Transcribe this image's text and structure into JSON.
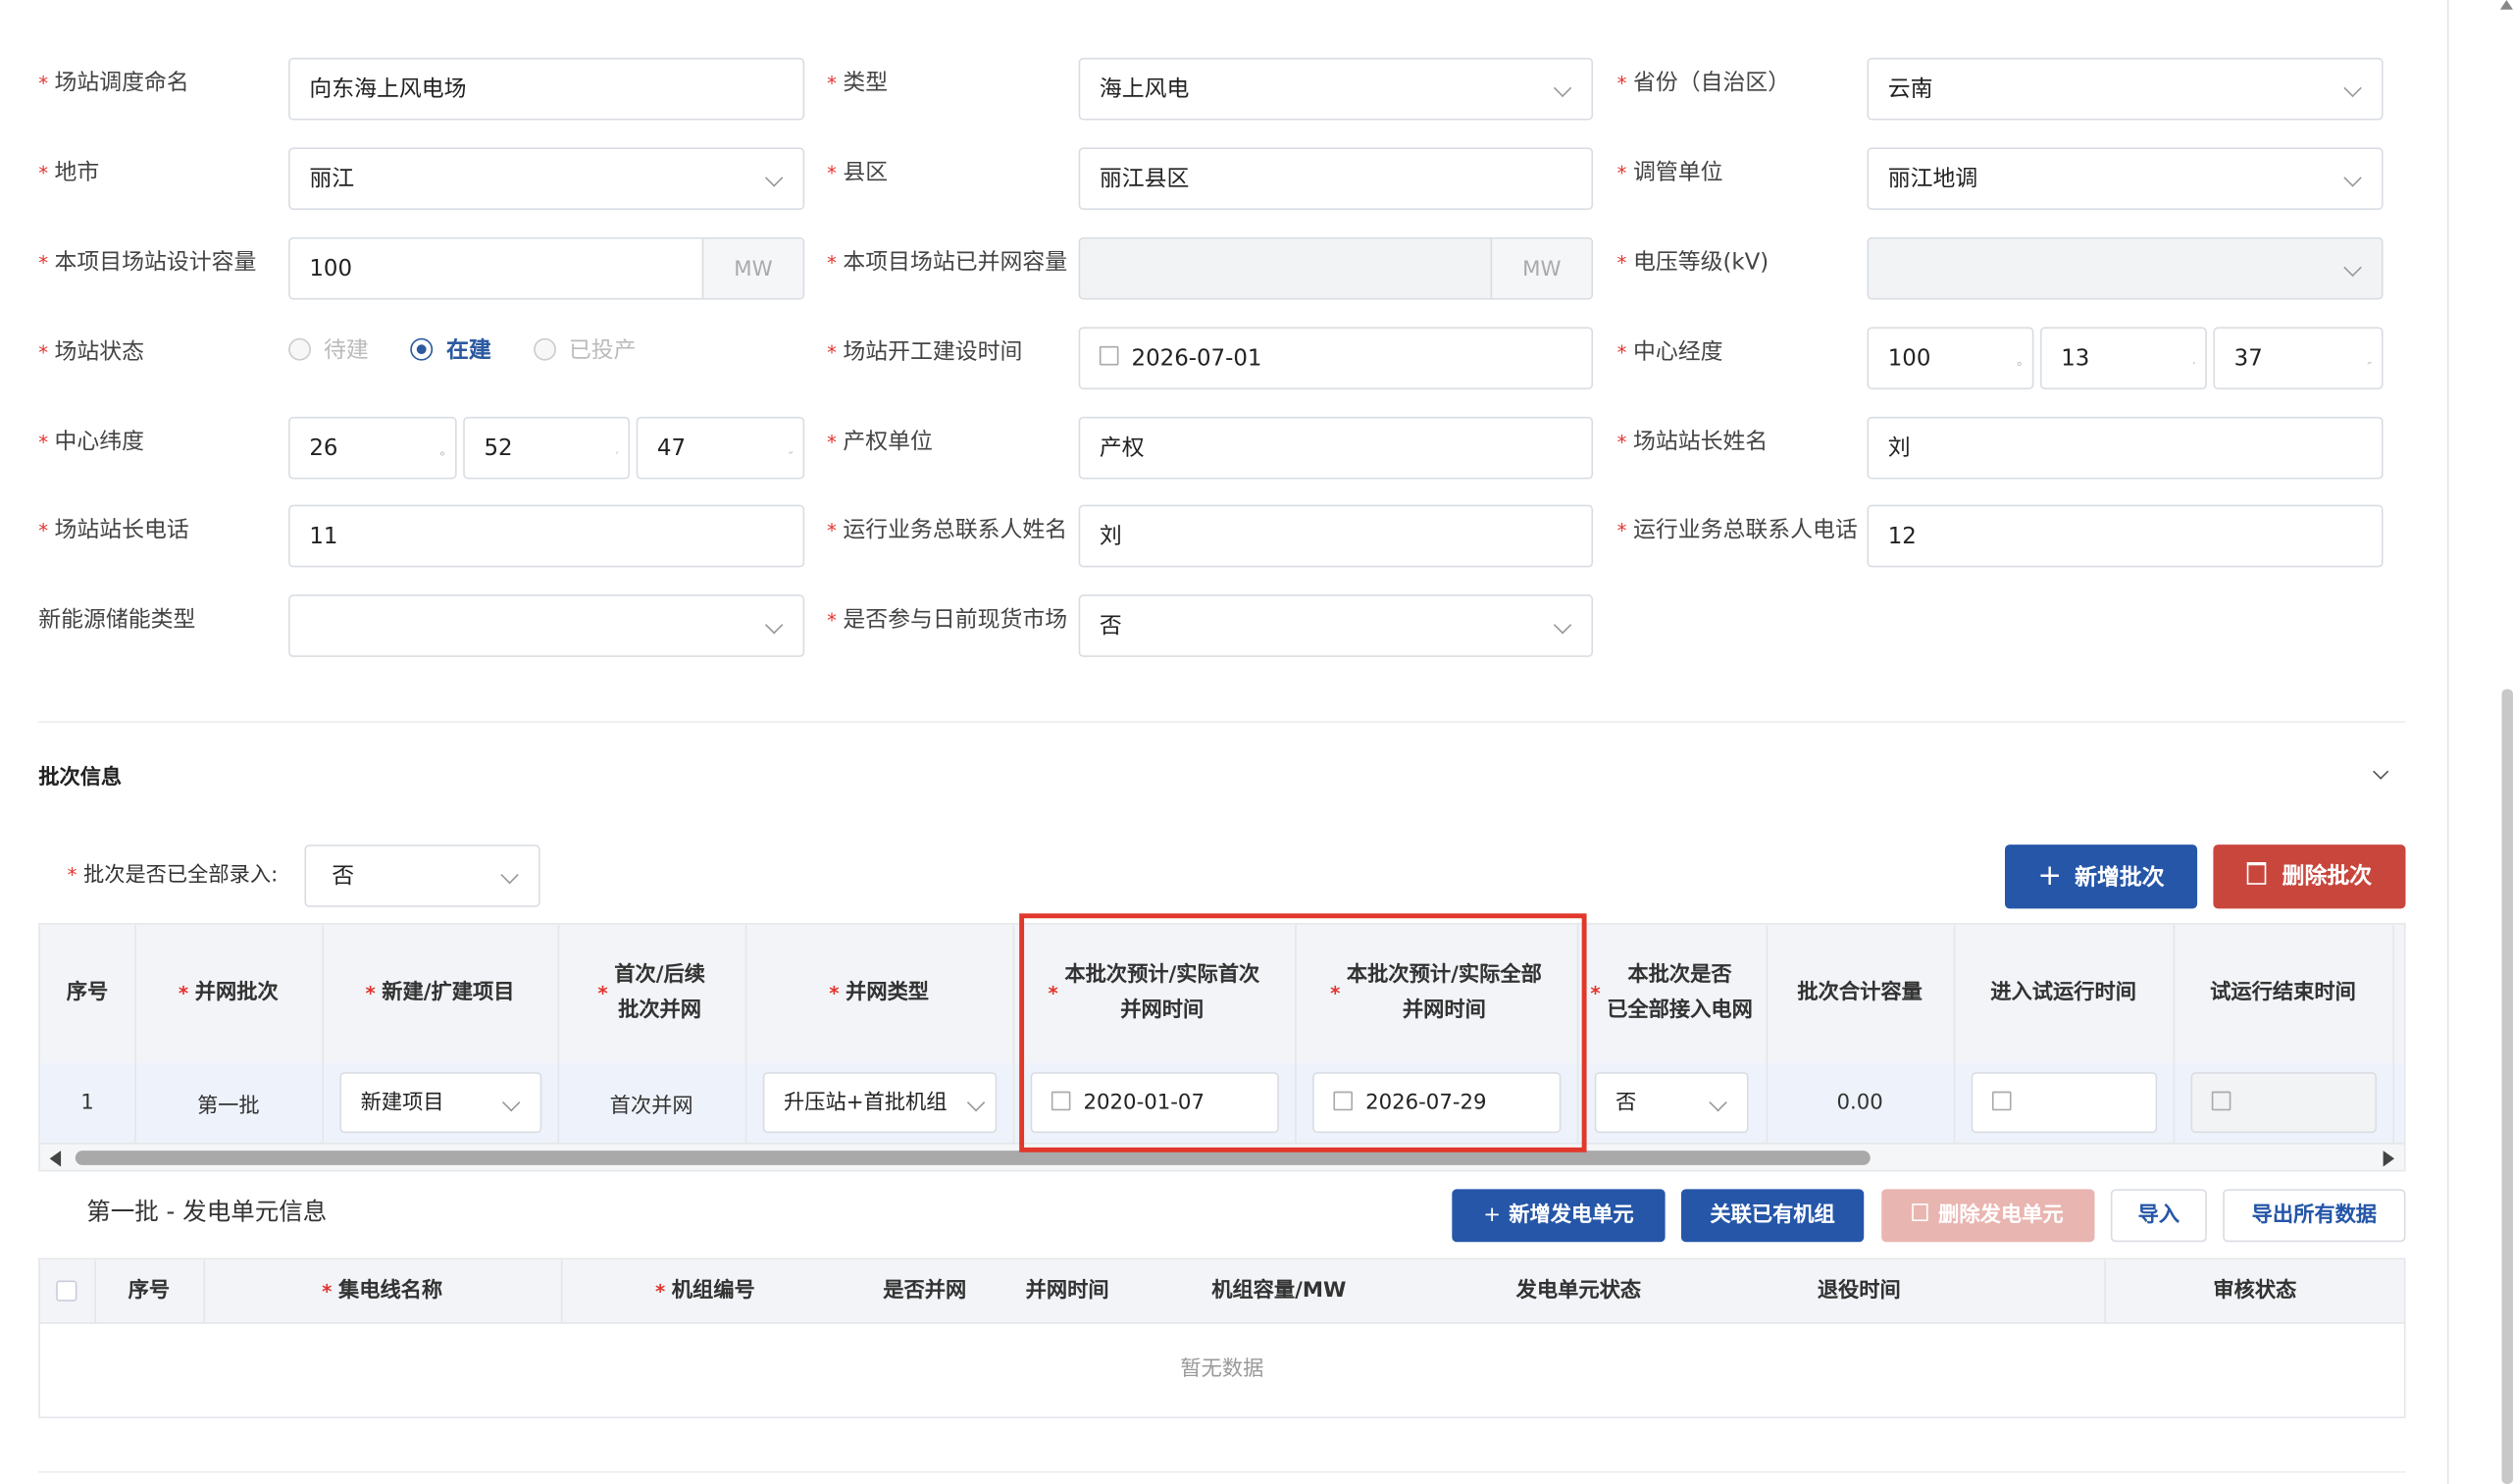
{
  "form": {
    "station_name": {
      "label": "场站调度命名",
      "value": "向东海上风电场"
    },
    "type": {
      "label": "类型",
      "value": "海上风电"
    },
    "province": {
      "label": "省份（自治区）",
      "value": "云南"
    },
    "city": {
      "label": "地市",
      "value": "丽江"
    },
    "county": {
      "label": "县区",
      "value": "丽江县区"
    },
    "dispatch_unit": {
      "label": "调管单位",
      "value": "丽江地调"
    },
    "design_capacity": {
      "label": "本项目场站设计容量",
      "value": "100",
      "unit": "MW"
    },
    "connected_capacity": {
      "label": "本项目场站已并网容量",
      "value": "",
      "unit": "MW"
    },
    "voltage_level": {
      "label": "电压等级(kV)",
      "value": ""
    },
    "station_status": {
      "label": "场站状态",
      "options": [
        "待建",
        "在建",
        "已投产"
      ],
      "selected": "在建"
    },
    "construction_start": {
      "label": "场站开工建设时间",
      "value": "2026-07-01"
    },
    "center_longitude": {
      "label": "中心经度",
      "deg": "100",
      "min": "13",
      "sec": "37"
    },
    "center_latitude": {
      "label": "中心纬度",
      "deg": "26",
      "min": "52",
      "sec": "47"
    },
    "property_unit": {
      "label": "产权单位",
      "value": "产权"
    },
    "manager_name": {
      "label": "场站站长姓名",
      "value": "刘"
    },
    "manager_phone": {
      "label": "场站站长电话",
      "value": "11"
    },
    "ops_contact_name": {
      "label": "运行业务总联系人姓名",
      "value": "刘"
    },
    "ops_contact_phone": {
      "label": "运行业务总联系人电话",
      "value": "12"
    },
    "storage_type": {
      "label": "新能源储能类型",
      "value": ""
    },
    "spot_market": {
      "label": "是否参与日前现货市场",
      "value": "否"
    }
  },
  "batch": {
    "section_title": "批次信息",
    "all_entered_label": "批次是否已全部录入:",
    "all_entered_value": "否",
    "add_button": "新增批次",
    "delete_button": "删除批次",
    "columns": [
      "序号",
      "并网批次",
      "新建/扩建项目",
      "首次/后续\n批次并网",
      "并网类型",
      "本批次预计/实际首次\n并网时间",
      "本批次预计/实际全部\n并网时间",
      "本批次是否\n已全部接入电网",
      "批次合计容量",
      "进入试运行时间",
      "试运行结束时间"
    ],
    "rows": [
      {
        "index": "1",
        "batch": "第一批",
        "project": "新建项目",
        "first_or_later": "首次并网",
        "grid_type": "升压站+首批机组",
        "first_time": "2020-01-07",
        "all_time": "2026-07-29",
        "all_connected": "否",
        "capacity": "0.00",
        "trial_start": "",
        "trial_end": ""
      }
    ]
  },
  "units": {
    "title": "第一批 - 发电单元信息",
    "add_button": "新增发电单元",
    "link_button": "关联已有机组",
    "delete_button": "删除发电单元",
    "import_button": "导入",
    "export_button": "导出所有数据",
    "columns": [
      "序号",
      "集电线名称",
      "机组编号",
      "是否并网",
      "并网时间",
      "机组容量/MW",
      "发电单元状态",
      "退役时间",
      "审核状态"
    ],
    "empty_text": "暂无数据"
  },
  "colors": {
    "primary": "#2556a8",
    "danger": "#c9463d",
    "highlight": "#e0382b"
  }
}
